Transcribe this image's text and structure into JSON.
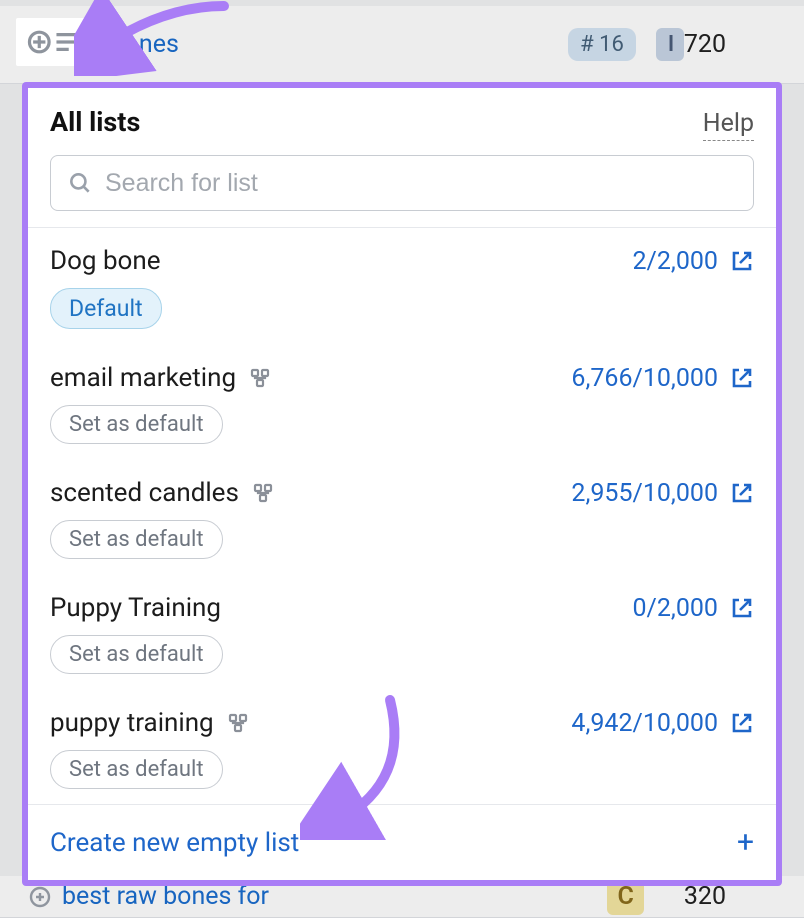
{
  "background": {
    "row1": {
      "keyword": "dog bones",
      "num_badge": "# 16",
      "intent": "I",
      "volume": "720"
    },
    "row2": {
      "keyword": "best raw bones for",
      "intent": "C",
      "volume": "320"
    }
  },
  "modal": {
    "title": "All lists",
    "help_label": "Help",
    "search_placeholder": "Search for list",
    "create_label": "Create new empty list",
    "default_badge": "Default",
    "set_default_label": "Set as default",
    "items": [
      {
        "name": "Dog bone",
        "count": "2/2,000",
        "shared": false,
        "is_default": true
      },
      {
        "name": "email marketing",
        "count": "6,766/10,000",
        "shared": true,
        "is_default": false
      },
      {
        "name": "scented candles",
        "count": "2,955/10,000",
        "shared": true,
        "is_default": false
      },
      {
        "name": "Puppy Training",
        "count": "0/2,000",
        "shared": false,
        "is_default": false
      },
      {
        "name": "puppy training",
        "count": "4,942/10,000",
        "shared": true,
        "is_default": false
      }
    ]
  },
  "colors": {
    "accent": "#a97df6",
    "link": "#1e66c9"
  }
}
